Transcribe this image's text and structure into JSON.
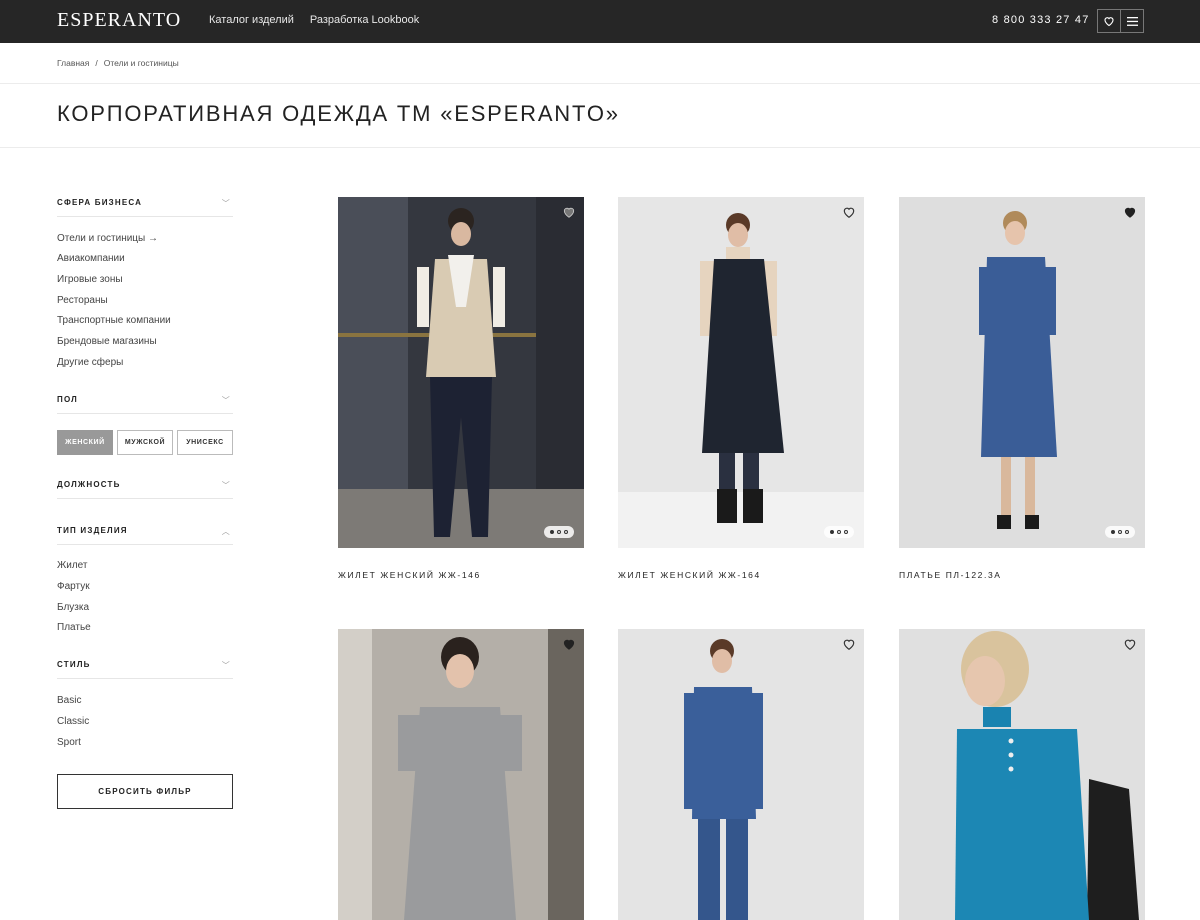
{
  "header": {
    "logo": "ESPERANTO",
    "nav": [
      "Каталог изделий",
      "Разработка Lookbook"
    ],
    "phone": "8 800 333 27 47"
  },
  "breadcrumb": {
    "home": "Главная",
    "sep": "/",
    "current": "Отели и гостиницы"
  },
  "page_title": "КОРПОРАТИВНАЯ ОДЕЖДА ТМ «ESPERANTO»",
  "filters": {
    "business": {
      "title": "СФЕРА БИЗНЕСА",
      "items": [
        "Отели и гостиницы →",
        "Авиакомпании",
        "Игровые зоны",
        "Рестораны",
        "Транспортные компании",
        "Брендовые магазины",
        "Другие сферы"
      ]
    },
    "gender": {
      "title": "ПОЛ",
      "options": [
        "ЖЕНСКИЙ",
        "МУЖСКОЙ",
        "УНИСЕКС"
      ],
      "selected": "ЖЕНСКИЙ"
    },
    "position": {
      "title": "ДОЛЖНОСТЬ"
    },
    "type": {
      "title": "ТИП ИЗДЕЛИЯ",
      "items": [
        "Жилет",
        "Фартук",
        "Блузка",
        "Платье"
      ]
    },
    "style": {
      "title": "СТИЛЬ",
      "items": [
        "Basic",
        "Classic",
        "Sport"
      ]
    },
    "reset_label": "СБРОСИТЬ ФИЛЬР"
  },
  "products": [
    {
      "title": "ЖИЛЕТ ЖЕНСКИЙ ЖЖ-146"
    },
    {
      "title": "ЖИЛЕТ ЖЕНСКИЙ ЖЖ-164"
    },
    {
      "title": "ПЛАТЬЕ ПЛ-122.3А"
    },
    {
      "title": ""
    },
    {
      "title": ""
    },
    {
      "title": ""
    }
  ],
  "colors": {
    "topbar": "#262626",
    "active_filter": "#999999",
    "text": "#222222"
  }
}
